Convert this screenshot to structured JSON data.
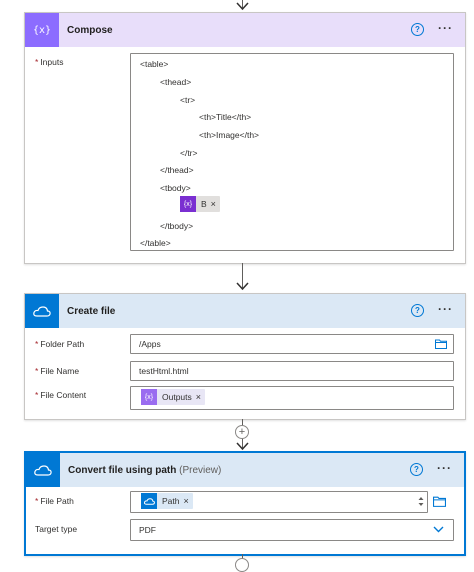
{
  "colors": {
    "compose_header": "#e8defa",
    "compose_icon_bg": "#8c6cff",
    "onedrive_header": "#dbe8f5",
    "onedrive_icon_bg": "#0078d4",
    "accent": "#0078d4",
    "token_purple": "#9a47e7"
  },
  "compose": {
    "title": "Compose",
    "icon": "curly-braces-icon",
    "inputs_label": "Inputs",
    "code_lines": [
      "<table>",
      "<thead>",
      "<tr>",
      "<th>Title</th>",
      "<th>Image</th>",
      "</tr>",
      "</thead>",
      "<tbody>",
      "</tbody>",
      "</table>"
    ],
    "token_label": "B",
    "token_icon": "expression-icon"
  },
  "create_file": {
    "title": "Create file",
    "icon": "onedrive-cloud-icon",
    "folder_path_label": "Folder Path",
    "folder_path_value": "/Apps",
    "file_name_label": "File Name",
    "file_name_value": "testHtml.html",
    "file_content_label": "File Content",
    "file_content_token": "Outputs"
  },
  "convert_file": {
    "title": "Convert file using path",
    "title_suffix": "(Preview)",
    "icon": "onedrive-cloud-icon",
    "file_path_label": "File Path",
    "file_path_token": "Path",
    "target_type_label": "Target type",
    "target_type_value": "PDF"
  },
  "common": {
    "help_glyph": "?",
    "more_glyph": "···",
    "required_mark": "*",
    "remove_glyph": "×"
  }
}
